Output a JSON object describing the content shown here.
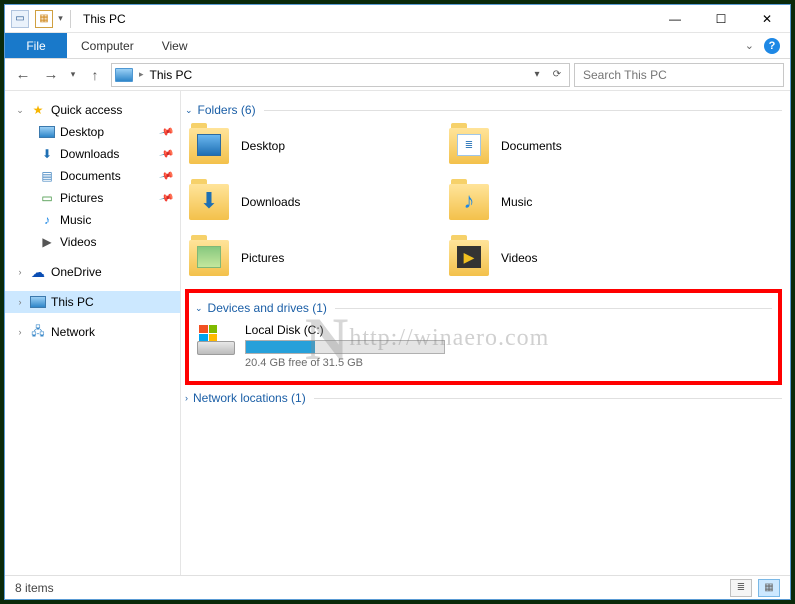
{
  "window": {
    "title": "This PC"
  },
  "ribbon": {
    "file": "File",
    "tabs": [
      "Computer",
      "View"
    ]
  },
  "address": {
    "path": "This PC"
  },
  "search": {
    "placeholder": "Search This PC"
  },
  "sidebar": {
    "quick_access": "Quick access",
    "items": [
      {
        "label": "Desktop",
        "pinned": true
      },
      {
        "label": "Downloads",
        "pinned": true
      },
      {
        "label": "Documents",
        "pinned": true
      },
      {
        "label": "Pictures",
        "pinned": true
      },
      {
        "label": "Music"
      },
      {
        "label": "Videos"
      }
    ],
    "onedrive": "OneDrive",
    "this_pc": "This PC",
    "network": "Network"
  },
  "groups": {
    "folders": {
      "title": "Folders (6)"
    },
    "drives": {
      "title": "Devices and drives (1)"
    },
    "network": {
      "title": "Network locations (1)"
    }
  },
  "folders": [
    {
      "label": "Desktop"
    },
    {
      "label": "Documents"
    },
    {
      "label": "Downloads"
    },
    {
      "label": "Music"
    },
    {
      "label": "Pictures"
    },
    {
      "label": "Videos"
    }
  ],
  "drive": {
    "name": "Local Disk (C:)",
    "free_text": "20.4 GB free of 31.5 GB",
    "used_pct": 35
  },
  "watermark": "http://winaero.com",
  "status": {
    "count": "8 items"
  }
}
